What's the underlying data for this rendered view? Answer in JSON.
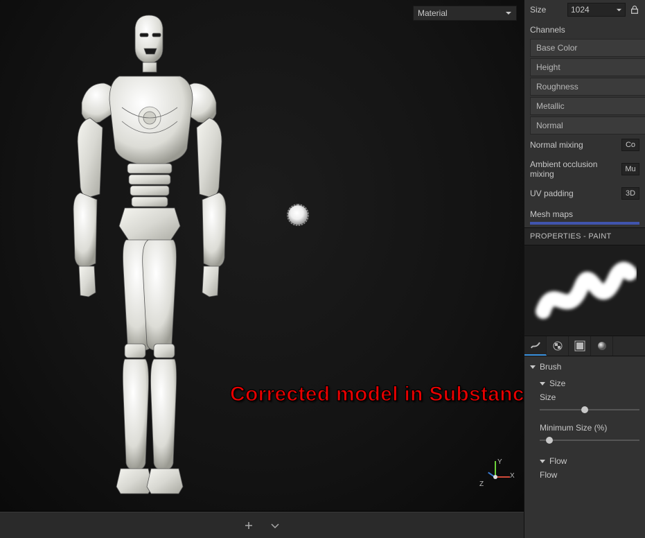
{
  "viewport": {
    "shading_dropdown": "Material",
    "annotation_text": "Corrected model in Substance Painter",
    "gizmo": {
      "x": "X",
      "y": "Y",
      "z": "Z"
    }
  },
  "texture_set": {
    "size_label": "Size",
    "size_value": "1024",
    "channels_label": "Channels",
    "channels": [
      "Base Color",
      "Height",
      "Roughness",
      "Metallic",
      "Normal"
    ],
    "normal_mixing_label": "Normal mixing",
    "normal_mixing_value": "Co",
    "ao_mixing_label": "Ambient occlusion mixing",
    "ao_mixing_value": "Mu",
    "uv_padding_label": "UV padding",
    "uv_padding_value": "3D",
    "mesh_maps_label": "Mesh maps"
  },
  "properties": {
    "panel_title": "PROPERTIES - PAINT",
    "mode_icons": [
      "brush-stroke-icon",
      "alpha-checker-icon",
      "stencil-icon",
      "sphere-icon"
    ],
    "active_mode_index": 0,
    "brush_group": "Brush",
    "size_group": "Size",
    "size_label": "Size",
    "size_slider_pct": 45,
    "min_size_label": "Minimum Size (%)",
    "min_size_slider_pct": 10,
    "flow_group": "Flow",
    "flow_label": "Flow"
  }
}
